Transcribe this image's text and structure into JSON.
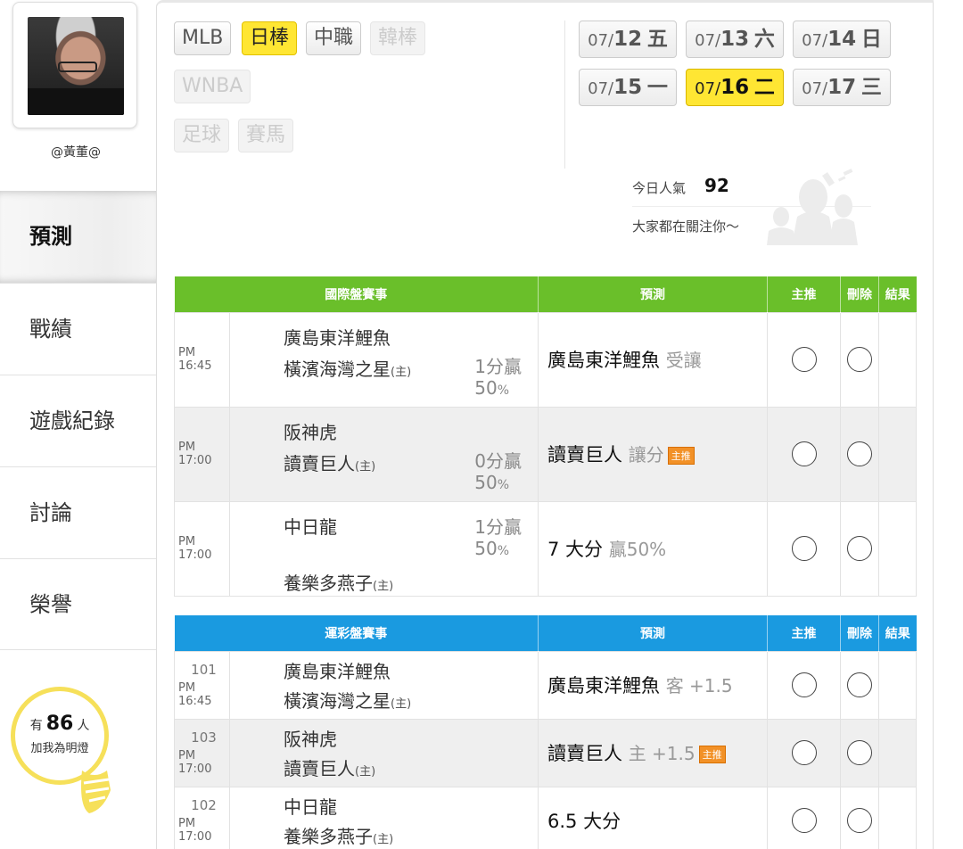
{
  "profile": {
    "username": "@黃董@"
  },
  "sidebar": {
    "items": [
      {
        "label": "預測",
        "active": true
      },
      {
        "label": "戰績"
      },
      {
        "label": "遊戲紀錄"
      },
      {
        "label": "討論"
      },
      {
        "label": "榮譽"
      }
    ],
    "bulb": {
      "prefix": "有",
      "count": "86",
      "suffix": "人",
      "caption": "加我為明燈"
    }
  },
  "leagues": [
    {
      "label": "MLB",
      "state": "normal"
    },
    {
      "label": "日棒",
      "state": "active"
    },
    {
      "label": "中職",
      "state": "normal"
    },
    {
      "label": "韓棒",
      "state": "disabled"
    },
    {
      "label": "WNBA",
      "state": "disabled"
    },
    {
      "label": "足球",
      "state": "disabled"
    },
    {
      "label": "賽馬",
      "state": "disabled"
    }
  ],
  "dates": [
    {
      "prefix": "07/",
      "day": "12",
      "weekday": "五",
      "active": false
    },
    {
      "prefix": "07/",
      "day": "13",
      "weekday": "六",
      "active": false
    },
    {
      "prefix": "07/",
      "day": "14",
      "weekday": "日",
      "active": false
    },
    {
      "prefix": "07/",
      "day": "15",
      "weekday": "一",
      "active": false
    },
    {
      "prefix": "07/",
      "day": "16",
      "weekday": "二",
      "active": true
    },
    {
      "prefix": "07/",
      "day": "17",
      "weekday": "三",
      "active": false
    }
  ],
  "popularity": {
    "label": "今日人氣",
    "value": "92",
    "message": "大家都在關注你～"
  },
  "intl_table": {
    "headers": {
      "match": "國際盤賽事",
      "prediction": "預測",
      "main_pick": "主推",
      "delete": "刪除",
      "result": "結果"
    },
    "rows": [
      {
        "time": "PM 16:45",
        "away": "廣島東洋鯉魚",
        "home": "橫濱海灣之星",
        "home_mark": "(主)",
        "odds": "1分贏",
        "odds_pct": "50",
        "pct_unit": "%",
        "pick": "廣島東洋鯉魚",
        "pick_sub": "受讓",
        "badge": ""
      },
      {
        "time": "PM 17:00",
        "away": "阪神虎",
        "home": "讀賣巨人",
        "home_mark": "(主)",
        "odds": "0分贏",
        "odds_pct": "50",
        "pct_unit": "%",
        "pick": "讀賣巨人",
        "pick_sub": "讓分",
        "badge": "主推"
      },
      {
        "time": "PM 17:00",
        "away": "中日龍",
        "home": "養樂多燕子",
        "home_mark": "(主)",
        "odds": "1分贏",
        "odds_pct": "50",
        "pct_unit": "%",
        "pick": "7 大分",
        "pick_sub": "贏50%",
        "badge": ""
      }
    ]
  },
  "lottery_table": {
    "headers": {
      "match": "運彩盤賽事",
      "prediction": "預測",
      "main_pick": "主推",
      "delete": "刪除",
      "result": "結果"
    },
    "rows": [
      {
        "num": "101",
        "time": "PM 16:45",
        "away": "廣島東洋鯉魚",
        "home": "橫濱海灣之星",
        "home_mark": "(主)",
        "pick": "廣島東洋鯉魚",
        "pick_sub": "客 +1.5",
        "badge": ""
      },
      {
        "num": "103",
        "time": "PM 17:00",
        "away": "阪神虎",
        "home": "讀賣巨人",
        "home_mark": "(主)",
        "pick": "讀賣巨人",
        "pick_sub": "主 +1.5",
        "badge": "主推"
      },
      {
        "num": "102",
        "time": "PM 17:00",
        "away": "中日龍",
        "home": "養樂多燕子",
        "home_mark": "(主)",
        "pick": "6.5 大分",
        "pick_sub": "",
        "badge": ""
      }
    ]
  },
  "colors": {
    "accent_yellow": "#ffe633",
    "intl_header": "#6abf2a",
    "lottery_header": "#1a9ae0",
    "badge": "#f29127"
  }
}
